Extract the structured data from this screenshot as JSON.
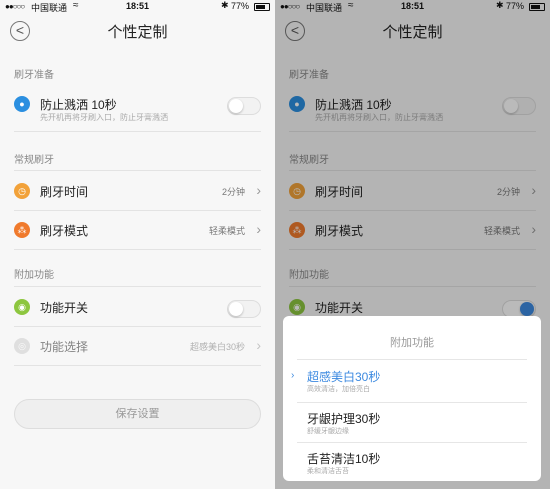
{
  "status": {
    "signal": "●●○○○",
    "carrier": "中国联通",
    "wifi": "≈",
    "time": "18:51",
    "bluetooth": "✱",
    "battery": "77%"
  },
  "nav": {
    "back": "<",
    "title": "个性定制"
  },
  "sections": {
    "prep": "刷牙准备",
    "regular": "常规刷牙",
    "extra": "附加功能"
  },
  "rows": {
    "splash": {
      "label": "防止溅洒 10秒",
      "sub": "先开机再将牙刷入口，防止牙膏溅洒"
    },
    "time": {
      "label": "刷牙时间",
      "value": "2分钟"
    },
    "mode": {
      "label": "刷牙模式",
      "value": "轻柔模式"
    },
    "func_switch": {
      "label": "功能开关"
    },
    "func_select": {
      "label": "功能选择",
      "value": "超感美白30秒"
    }
  },
  "save_label": "保存设置",
  "sheet": {
    "title": "附加功能",
    "options": [
      {
        "label": "超感美白30秒",
        "sub": "高效清洁，加倍亮白",
        "selected": true
      },
      {
        "label": "牙龈护理30秒",
        "sub": "舒缓牙龈边缘",
        "selected": false
      },
      {
        "label": "舌苔清洁10秒",
        "sub": "柔和清洁舌苔",
        "selected": false
      }
    ]
  },
  "colors": {
    "drop": "#2b8fe0",
    "time": "#f2a23a",
    "mode": "#f07a2c",
    "func": "#8dc63f",
    "func_select": "#cccccc",
    "accent": "#3d8ae0"
  },
  "icons": {
    "drop": "💧",
    "clock": "◷",
    "mode": "⁂",
    "func": "◉",
    "func_select": "◎",
    "chevron": "›",
    "marker": "›"
  }
}
